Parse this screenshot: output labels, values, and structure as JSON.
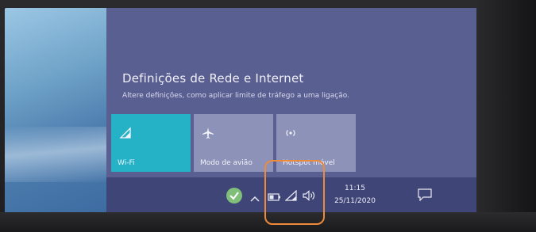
{
  "network_panel": {
    "title": "Definições de Rede e Internet",
    "description": "Altere definições, como aplicar limite de tráfego a uma ligação."
  },
  "quick_actions": [
    {
      "label": "Wi-Fi",
      "icon": "wifi-icon",
      "active": true
    },
    {
      "label": "Modo de avião",
      "icon": "airplane-icon",
      "active": false
    },
    {
      "label": "Hotspot móvel",
      "icon": "hotspot-icon",
      "active": false
    }
  ],
  "taskbar": {
    "time": "11:15",
    "date": "25/11/2020"
  },
  "colors": {
    "active_tile": "#25b2c6",
    "inactive_tile": "#8d92b8",
    "highlight": "#ee8a3a",
    "flyout": "#5a5f92",
    "taskbar": "#3f4577"
  }
}
